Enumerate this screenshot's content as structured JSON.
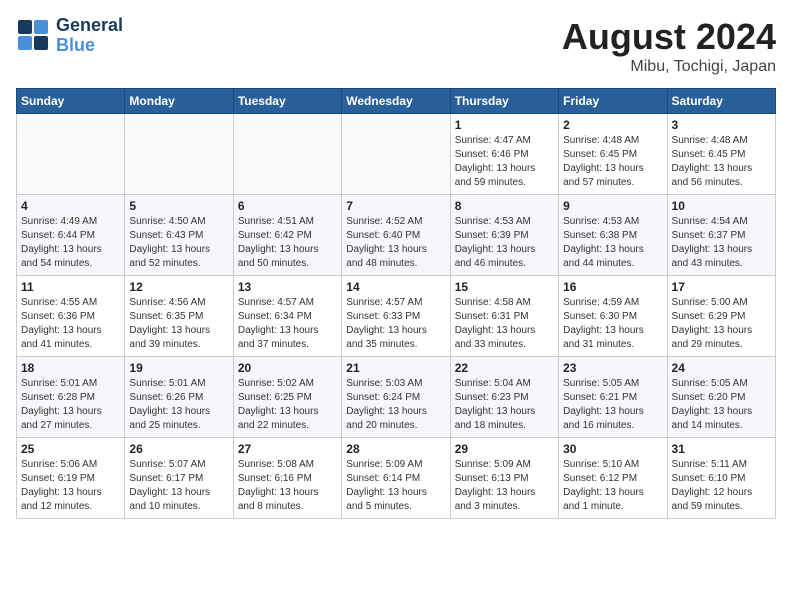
{
  "logo": {
    "line1": "General",
    "line2": "Blue"
  },
  "title": "August 2024",
  "subtitle": "Mibu, Tochigi, Japan",
  "days_of_week": [
    "Sunday",
    "Monday",
    "Tuesday",
    "Wednesday",
    "Thursday",
    "Friday",
    "Saturday"
  ],
  "weeks": [
    [
      {
        "day": "",
        "info": ""
      },
      {
        "day": "",
        "info": ""
      },
      {
        "day": "",
        "info": ""
      },
      {
        "day": "",
        "info": ""
      },
      {
        "day": "1",
        "info": "Sunrise: 4:47 AM\nSunset: 6:46 PM\nDaylight: 13 hours\nand 59 minutes."
      },
      {
        "day": "2",
        "info": "Sunrise: 4:48 AM\nSunset: 6:45 PM\nDaylight: 13 hours\nand 57 minutes."
      },
      {
        "day": "3",
        "info": "Sunrise: 4:48 AM\nSunset: 6:45 PM\nDaylight: 13 hours\nand 56 minutes."
      }
    ],
    [
      {
        "day": "4",
        "info": "Sunrise: 4:49 AM\nSunset: 6:44 PM\nDaylight: 13 hours\nand 54 minutes."
      },
      {
        "day": "5",
        "info": "Sunrise: 4:50 AM\nSunset: 6:43 PM\nDaylight: 13 hours\nand 52 minutes."
      },
      {
        "day": "6",
        "info": "Sunrise: 4:51 AM\nSunset: 6:42 PM\nDaylight: 13 hours\nand 50 minutes."
      },
      {
        "day": "7",
        "info": "Sunrise: 4:52 AM\nSunset: 6:40 PM\nDaylight: 13 hours\nand 48 minutes."
      },
      {
        "day": "8",
        "info": "Sunrise: 4:53 AM\nSunset: 6:39 PM\nDaylight: 13 hours\nand 46 minutes."
      },
      {
        "day": "9",
        "info": "Sunrise: 4:53 AM\nSunset: 6:38 PM\nDaylight: 13 hours\nand 44 minutes."
      },
      {
        "day": "10",
        "info": "Sunrise: 4:54 AM\nSunset: 6:37 PM\nDaylight: 13 hours\nand 43 minutes."
      }
    ],
    [
      {
        "day": "11",
        "info": "Sunrise: 4:55 AM\nSunset: 6:36 PM\nDaylight: 13 hours\nand 41 minutes."
      },
      {
        "day": "12",
        "info": "Sunrise: 4:56 AM\nSunset: 6:35 PM\nDaylight: 13 hours\nand 39 minutes."
      },
      {
        "day": "13",
        "info": "Sunrise: 4:57 AM\nSunset: 6:34 PM\nDaylight: 13 hours\nand 37 minutes."
      },
      {
        "day": "14",
        "info": "Sunrise: 4:57 AM\nSunset: 6:33 PM\nDaylight: 13 hours\nand 35 minutes."
      },
      {
        "day": "15",
        "info": "Sunrise: 4:58 AM\nSunset: 6:31 PM\nDaylight: 13 hours\nand 33 minutes."
      },
      {
        "day": "16",
        "info": "Sunrise: 4:59 AM\nSunset: 6:30 PM\nDaylight: 13 hours\nand 31 minutes."
      },
      {
        "day": "17",
        "info": "Sunrise: 5:00 AM\nSunset: 6:29 PM\nDaylight: 13 hours\nand 29 minutes."
      }
    ],
    [
      {
        "day": "18",
        "info": "Sunrise: 5:01 AM\nSunset: 6:28 PM\nDaylight: 13 hours\nand 27 minutes."
      },
      {
        "day": "19",
        "info": "Sunrise: 5:01 AM\nSunset: 6:26 PM\nDaylight: 13 hours\nand 25 minutes."
      },
      {
        "day": "20",
        "info": "Sunrise: 5:02 AM\nSunset: 6:25 PM\nDaylight: 13 hours\nand 22 minutes."
      },
      {
        "day": "21",
        "info": "Sunrise: 5:03 AM\nSunset: 6:24 PM\nDaylight: 13 hours\nand 20 minutes."
      },
      {
        "day": "22",
        "info": "Sunrise: 5:04 AM\nSunset: 6:23 PM\nDaylight: 13 hours\nand 18 minutes."
      },
      {
        "day": "23",
        "info": "Sunrise: 5:05 AM\nSunset: 6:21 PM\nDaylight: 13 hours\nand 16 minutes."
      },
      {
        "day": "24",
        "info": "Sunrise: 5:05 AM\nSunset: 6:20 PM\nDaylight: 13 hours\nand 14 minutes."
      }
    ],
    [
      {
        "day": "25",
        "info": "Sunrise: 5:06 AM\nSunset: 6:19 PM\nDaylight: 13 hours\nand 12 minutes."
      },
      {
        "day": "26",
        "info": "Sunrise: 5:07 AM\nSunset: 6:17 PM\nDaylight: 13 hours\nand 10 minutes."
      },
      {
        "day": "27",
        "info": "Sunrise: 5:08 AM\nSunset: 6:16 PM\nDaylight: 13 hours\nand 8 minutes."
      },
      {
        "day": "28",
        "info": "Sunrise: 5:09 AM\nSunset: 6:14 PM\nDaylight: 13 hours\nand 5 minutes."
      },
      {
        "day": "29",
        "info": "Sunrise: 5:09 AM\nSunset: 6:13 PM\nDaylight: 13 hours\nand 3 minutes."
      },
      {
        "day": "30",
        "info": "Sunrise: 5:10 AM\nSunset: 6:12 PM\nDaylight: 13 hours\nand 1 minute."
      },
      {
        "day": "31",
        "info": "Sunrise: 5:11 AM\nSunset: 6:10 PM\nDaylight: 12 hours\nand 59 minutes."
      }
    ]
  ]
}
